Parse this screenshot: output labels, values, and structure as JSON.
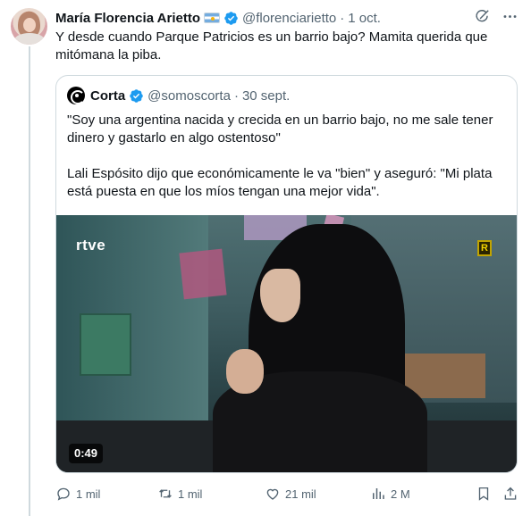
{
  "tweet": {
    "author_name": "María Florencia Arietto",
    "handle": "@florenciarietto",
    "separator": "·",
    "timestamp": "1 oct.",
    "text": "Y desde cuando Parque Patricios es un barrio bajo? Mamita querida que mitómana la piba.",
    "icons": [
      "grok-icon",
      "more-icon"
    ]
  },
  "quoted_tweet": {
    "author_name": "Corta",
    "handle": "@somoscorta",
    "separator": "·",
    "timestamp": "30 sept.",
    "paragraph_1": "\"Soy una argentina nacida y crecida en un barrio bajo, no me sale tener dinero y gastarlo en algo ostentoso\"",
    "paragraph_2": "Lali Espósito dijo que económicamente le va \"bien\" y aseguró: \"Mi plata está puesta en que los míos tengan una mejor vida\".",
    "video": {
      "channel_logo": "rtve",
      "badge": "R",
      "duration": "0:49"
    }
  },
  "actions": {
    "replies": "1 mil",
    "retweets": "1 mil",
    "likes": "21 mil",
    "views": "2 M"
  },
  "colors": {
    "verified": "#1d9bf0",
    "secondary_text": "#536471",
    "border": "#cfd9de"
  }
}
